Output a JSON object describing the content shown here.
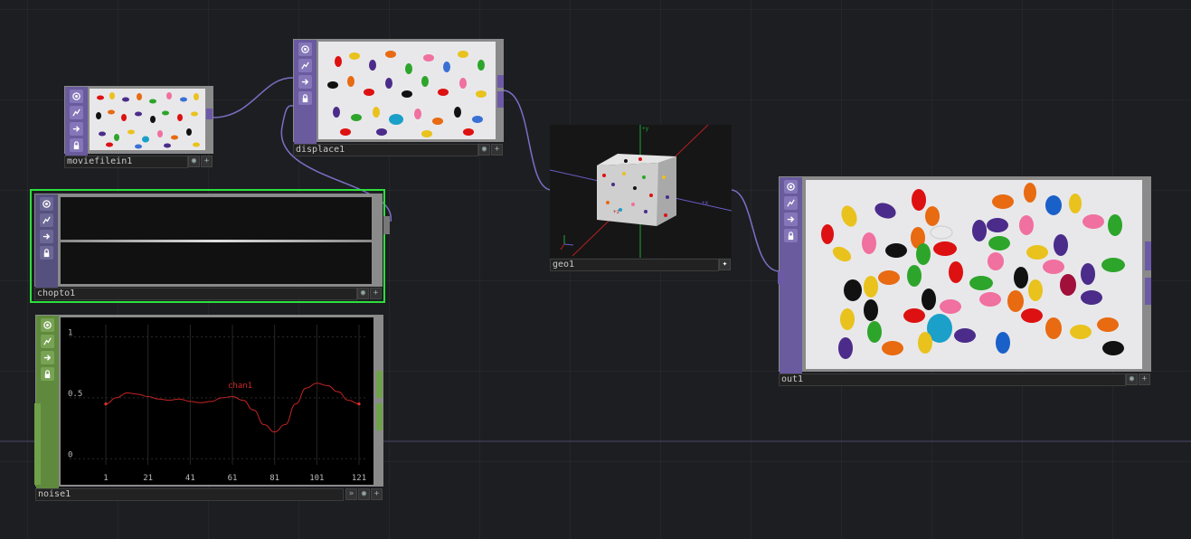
{
  "nodes": {
    "moviefilein": {
      "name": "moviefilein1"
    },
    "displace": {
      "name": "displace1"
    },
    "chopto": {
      "name": "chopto1"
    },
    "noise": {
      "name": "noise1",
      "channel": "chan1",
      "y_ticks": [
        "1",
        "0.5",
        "0"
      ],
      "x_ticks": [
        "1",
        "21",
        "41",
        "61",
        "81",
        "101",
        "121"
      ]
    },
    "geo": {
      "name": "geo1",
      "axes": {
        "x": "+x",
        "y": "+y",
        "z": "+z"
      }
    },
    "out": {
      "name": "out1"
    }
  },
  "colors": {
    "background": "#1d1e22",
    "top_family": "#6a5a9e",
    "chop_family": "#5f8a3d",
    "selection": "#2be03a",
    "wire": "#7a6fc4",
    "curve": "#c42424"
  },
  "icons": [
    "viewer-icon",
    "bypass-icon",
    "cook-arrow-icon",
    "lock-icon",
    "plus-icon"
  ],
  "chart_data": {
    "type": "line",
    "series": [
      {
        "name": "chan1",
        "x": [
          1,
          6,
          11,
          16,
          21,
          26,
          31,
          36,
          41,
          46,
          51,
          56,
          61,
          66,
          71,
          76,
          81,
          86,
          91,
          96,
          101,
          106,
          111,
          116,
          121
        ],
        "values": [
          0.45,
          0.5,
          0.54,
          0.53,
          0.51,
          0.49,
          0.48,
          0.49,
          0.47,
          0.46,
          0.47,
          0.5,
          0.51,
          0.48,
          0.4,
          0.28,
          0.22,
          0.28,
          0.45,
          0.58,
          0.62,
          0.6,
          0.55,
          0.48,
          0.45
        ]
      }
    ],
    "xlabel": "",
    "ylabel": "",
    "xlim": [
      1,
      121
    ],
    "ylim": [
      -0.05,
      1.1
    ],
    "x_ticks": [
      1,
      21,
      41,
      61,
      81,
      101,
      121
    ],
    "y_ticks": [
      0,
      0.5,
      1
    ],
    "grid": true
  }
}
